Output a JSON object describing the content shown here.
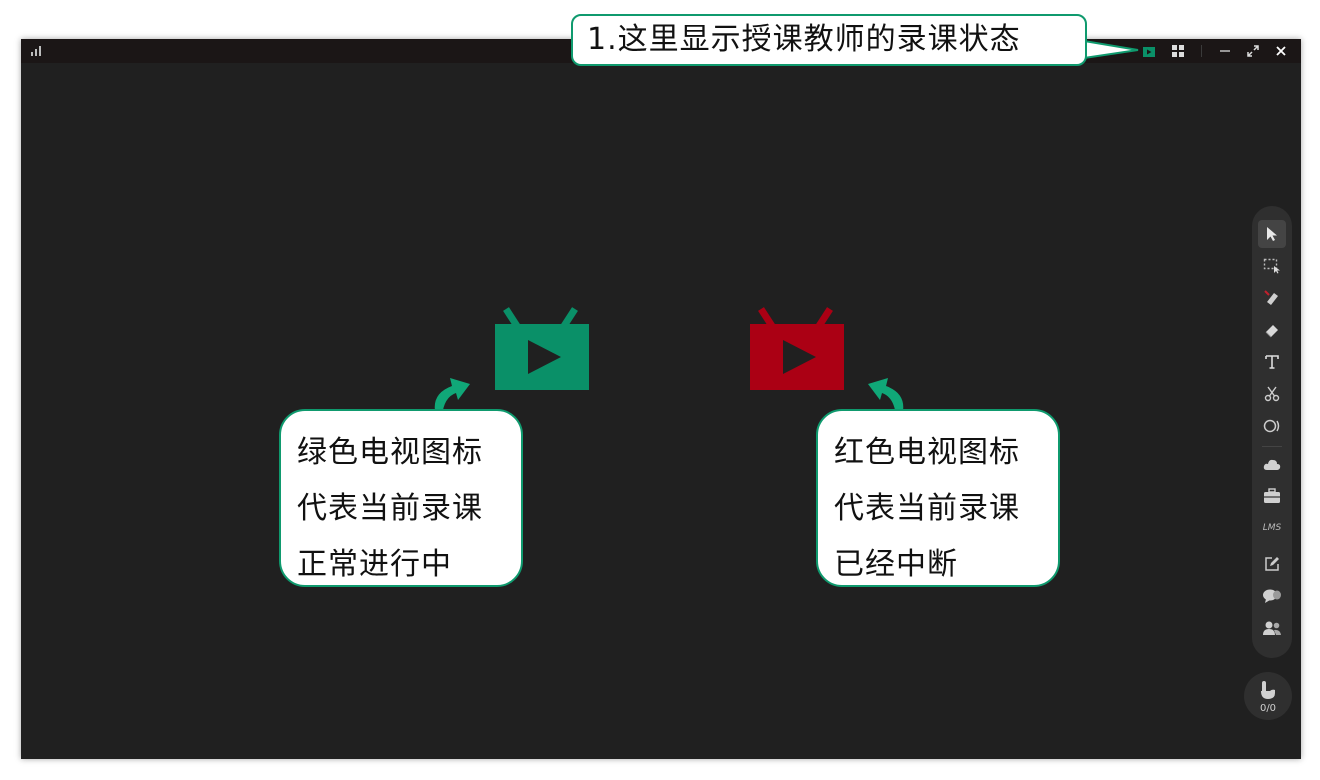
{
  "titlebar": {
    "icons": [
      "signal-icon",
      "recording-status-icon",
      "grid-icon",
      "minimize-icon",
      "restore-icon",
      "close-icon"
    ]
  },
  "colors": {
    "recording_ok": "#0a9068",
    "recording_interrupted": "#ab0014",
    "callout_border": "#0f9a6e",
    "canvas": "#202020"
  },
  "annotations": {
    "top": "1.这里显示授课教师的录课状态",
    "green": [
      "绿色电视图标",
      "代表当前录课",
      "正常进行中"
    ],
    "red": [
      "红色电视图标",
      "代表当前录课",
      "已经中断"
    ]
  },
  "toolbar": {
    "tools": [
      "select-arrow",
      "box-select",
      "pen",
      "eraser",
      "text",
      "scissors",
      "shapes",
      "cloud",
      "toolbox",
      "LMS",
      "edit-note",
      "chat",
      "participants"
    ],
    "lms_label": "LMS"
  },
  "hand_raise": {
    "count": "0/0"
  }
}
